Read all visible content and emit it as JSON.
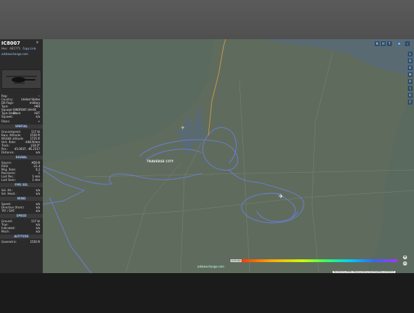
{
  "header": {
    "callsign": "IC8007",
    "hex_label": "Hex:",
    "hex": "AE1771",
    "type_tag": "Copy Link",
    "site": "adsbexchange.com",
    "close": "×"
  },
  "info_rows": [
    {
      "k": "Reg:",
      "v": "--"
    },
    {
      "k": "Country:",
      "v": "United States"
    },
    {
      "k": "DB flags:",
      "v": "military"
    },
    {
      "k": "Type:",
      "v": "H60"
    },
    {
      "k": "Squawk:",
      "v": "SIKORSKY UH-60 Black"
    },
    {
      "k": "Type Desc:",
      "v": "H2T"
    },
    {
      "k": "Squawk:",
      "v": "n/a"
    }
  ],
  "sections": {
    "filters": "Filters",
    "spatial": "SPATIAL",
    "signal": "SIGNAL",
    "fms": "FMS SEL",
    "wind": "WIND",
    "speed": "SPEED",
    "altitude": "ALTITUDE"
  },
  "spatial_rows": [
    {
      "k": "Groundspeed:",
      "v": "117 kt"
    },
    {
      "k": "Baro. Altitude:",
      "v": "1550 ft"
    },
    {
      "k": "WGS84 altitude:",
      "v": "1725 ft"
    },
    {
      "k": "Vert. Rate:",
      "v": "-448 ft/min"
    },
    {
      "k": "Track:",
      "v": "234.0°"
    },
    {
      "k": "Pos.:",
      "v": "45.0037, -85.2157"
    },
    {
      "k": "Distance:",
      "v": "n/a"
    }
  ],
  "signal_rows": [
    {
      "k": "Source:",
      "v": "ADS-B"
    },
    {
      "k": "RSSI:",
      "v": "-21.4"
    },
    {
      "k": "Msg. Rate:",
      "v": "0.2"
    },
    {
      "k": "Receivers:",
      "v": "1"
    },
    {
      "k": "Last Pos.:",
      "v": "1 min"
    },
    {
      "k": "Last Seen:",
      "v": "1 min"
    }
  ],
  "fms_rows": [
    {
      "k": "Sel. Alt.:",
      "v": "n/a"
    },
    {
      "k": "Sel. Head.:",
      "v": "n/a"
    }
  ],
  "wind_rows": [
    {
      "k": "Speed:",
      "v": "n/a"
    },
    {
      "k": "Direction (from):",
      "v": "n/a"
    },
    {
      "k": "TAT / OAT:",
      "v": "n/a"
    }
  ],
  "speed_rows": [
    {
      "k": "Ground:",
      "v": "117 kt"
    },
    {
      "k": "True:",
      "v": "n/a"
    },
    {
      "k": "Indicated:",
      "v": "n/a"
    },
    {
      "k": "Mach:",
      "v": "n/a"
    }
  ],
  "altitude_rows": [
    {
      "k": "Geometric:",
      "v": "1550 ft"
    }
  ],
  "map": {
    "city_label": "TRAVERSE CITY",
    "logo": "adsbexchange.com",
    "attribution": "Rendered by ADSBx. Mapping data by OpenStreetMap contributors",
    "legend_min": "ALTITUDE",
    "legend_max": "40000",
    "top_buttons": [
      "N",
      "H",
      "T"
    ],
    "side_buttons": [
      "L",
      "O",
      "K",
      "M",
      "P",
      "I",
      "R",
      "F"
    ],
    "zoom_in": "+",
    "zoom_out": "−"
  },
  "colors": {
    "water": "#5a6f78",
    "land": "#5e6b5d",
    "track": "#6b7fe6",
    "legend_gradient": [
      "#ff3300",
      "#ffaa00",
      "#ccff00",
      "#33ff66",
      "#00ccff",
      "#3366ff",
      "#aa33ff"
    ]
  }
}
